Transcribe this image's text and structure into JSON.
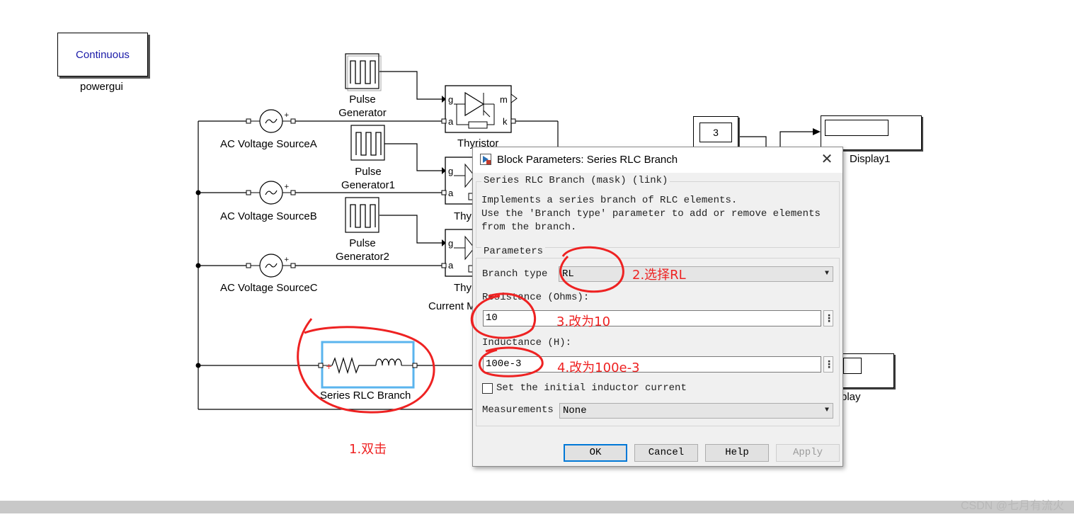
{
  "model": {
    "powergui": {
      "box_text": "Continuous",
      "label": "powergui"
    },
    "sources": [
      {
        "label": "AC Voltage SourceA"
      },
      {
        "label": "AC Voltage SourceB"
      },
      {
        "label": "AC Voltage SourceC"
      }
    ],
    "pulse_generators": [
      {
        "label_line1": "Pulse",
        "label_line2": "Generator"
      },
      {
        "label_line1": "Pulse",
        "label_line2": "Generator1"
      },
      {
        "label_line1": "Pulse",
        "label_line2": "Generator2"
      }
    ],
    "thyristor": {
      "label_full": "Thyristor",
      "label_short": "Thy",
      "ports": {
        "g": "g",
        "a": "a",
        "m": "m",
        "k": "k"
      }
    },
    "current_measurement_label_partial": "Current M",
    "rlc_branch": {
      "label": "Series RLC Branch"
    },
    "constant": {
      "value": "3"
    },
    "display1": {
      "label": "Display1"
    },
    "display": {
      "label_partial": "play"
    }
  },
  "dialog": {
    "title": "Block Parameters: Series RLC Branch",
    "close_glyph": "✕",
    "mask_group_title": "Series RLC Branch (mask) (link)",
    "description": "Implements a series branch of RLC elements.\nUse the 'Branch type' parameter to add or remove elements\nfrom the branch.",
    "params_group_title": "Parameters",
    "branch_type_label": "Branch type",
    "branch_type_value": "RL",
    "resistance_label": "Resistance (Ohms):",
    "resistance_value": "10",
    "inductance_label": "Inductance (H):",
    "inductance_value": "100e-3",
    "dots": "⋮",
    "initial_current_label": "Set the initial inductor current",
    "initial_current_checked": false,
    "measurements_label": "Measurements",
    "measurements_value": "None",
    "buttons": {
      "ok": "OK",
      "cancel": "Cancel",
      "help": "Help",
      "apply": "Apply"
    }
  },
  "annotations": {
    "step1": "1.双击",
    "step2": "2.选择RL",
    "step3": "3.改为10",
    "step4": "4.改为100e-3",
    "color": "#ee2222"
  },
  "watermark": "CSDN @七月有流火",
  "colors": {
    "selection": "#5ab4ee",
    "ok_focus": "#0078d7",
    "powergui_text": "#1a1aa8"
  }
}
